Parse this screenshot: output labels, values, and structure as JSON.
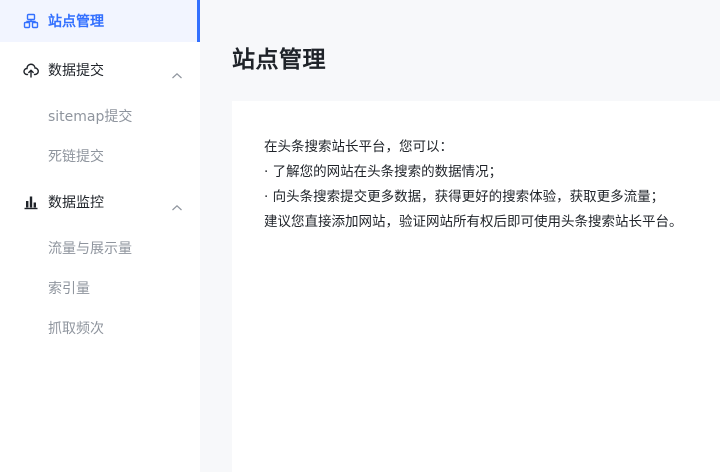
{
  "sidebar": {
    "top_item": {
      "label": "站点管理",
      "icon": "site-icon"
    },
    "groups": [
      {
        "label": "数据提交",
        "icon": "cloud-upload-icon",
        "items": [
          {
            "label": "sitemap提交"
          },
          {
            "label": "死链提交"
          }
        ]
      },
      {
        "label": "数据监控",
        "icon": "bar-chart-icon",
        "items": [
          {
            "label": "流量与展示量"
          },
          {
            "label": "索引量"
          },
          {
            "label": "抓取频次"
          }
        ]
      }
    ]
  },
  "main": {
    "title": "站点管理",
    "intro_lines": [
      "在头条搜索站长平台，您可以：",
      "· 了解您的网站在头条搜索的数据情况；",
      "· 向头条搜索提交更多数据，获得更好的搜索体验，获取更多流量；",
      "建议您直接添加网站，验证网站所有权后即可使用头条搜索站长平台。"
    ]
  },
  "colors": {
    "accent": "#3370ff",
    "active_bg": "#f2f5ff",
    "muted_text": "#8f959e",
    "page_bg": "#f7f8fa"
  }
}
